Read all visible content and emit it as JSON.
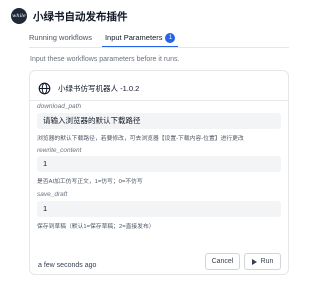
{
  "app": {
    "logo_text": "while",
    "title": "小绿书自动发布插件"
  },
  "tabs": [
    {
      "label": "Running workflows",
      "active": false
    },
    {
      "label": "Input Parameters",
      "active": true,
      "badge": "1"
    }
  ],
  "hint": "Input these workflows parameters before it runs.",
  "workflow": {
    "icon": "globe-icon",
    "name": "小绿书仿写机器人 -1.0.2"
  },
  "fields": [
    {
      "label": "download_path",
      "value": "请输入浏览器的默认下载路径",
      "help": "浏览器的默认下载路径，若要修改，可去浏览器【设置-下载内容-位置】进行更改"
    },
    {
      "label": "rewrite_content",
      "value": "1",
      "help": "是否AI加工仿写正文，1=仿写；0=不仿写"
    },
    {
      "label": "save_draft",
      "value": "1",
      "help": "保存到草稿（默认1=保存草稿；2=直接发布）"
    }
  ],
  "footer": {
    "timestamp": "a few seconds ago",
    "cancel_label": "Cancel",
    "run_label": "Run"
  },
  "colors": {
    "accent": "#2563eb",
    "input_bg": "#f3f4f6",
    "border": "#e5e7eb"
  }
}
